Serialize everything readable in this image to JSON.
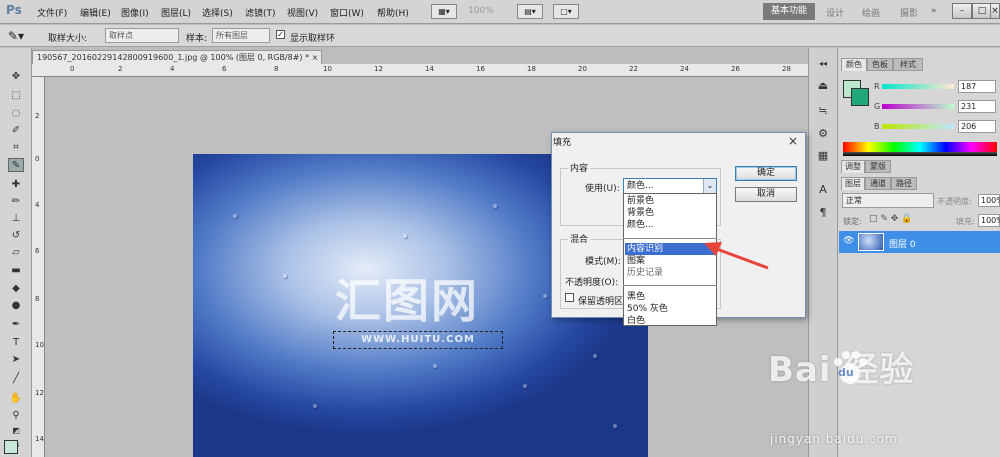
{
  "app": {
    "logo": "Ps"
  },
  "menubar": {
    "items": [
      "文件(F)",
      "编辑(E)",
      "图像(I)",
      "图层(L)",
      "选择(S)",
      "滤镜(T)",
      "视图(V)",
      "窗口(W)",
      "帮助(H)"
    ],
    "zoom": "100%",
    "workspaces": {
      "active": "基本功能",
      "design": "设计",
      "painting": "绘画",
      "photo": "摄影"
    },
    "window_buttons": [
      "–",
      "□",
      "×"
    ]
  },
  "options_bar": {
    "sample_size_label": "取样大小:",
    "sample_size_value": "取样点",
    "sample_label": "样本:",
    "sample_value": "所有图层",
    "show_ring_label": "显示取样环",
    "show_ring_checked": true
  },
  "document": {
    "tab_title": "190567_20160229142800919600_1.jpg @ 100% (图层 0, RGB/8#) * ×",
    "ruler_top": [
      "0",
      "2",
      "4",
      "6",
      "8",
      "10",
      "12",
      "14",
      "16",
      "18",
      "20",
      "22",
      "24",
      "26",
      "28"
    ],
    "ruler_left": [
      "0",
      "2",
      "4",
      "6",
      "8",
      "10",
      "12",
      "14"
    ],
    "watermark_logo": "汇图网",
    "watermark_url": "WWW.HUITU.COM"
  },
  "panels": {
    "color_tabs": [
      "颜色",
      "色板",
      "样式"
    ],
    "rgb": {
      "r_label": "R",
      "r_value": "187",
      "g_label": "G",
      "g_value": "231",
      "b_label": "B",
      "b_value": "206"
    },
    "adjust_tabs": [
      "调整",
      "蒙版"
    ],
    "layer_tabs": [
      "图层",
      "通道",
      "路径"
    ],
    "blend_mode": "正常",
    "opacity_label": "不透明度:",
    "opacity_value": "100%",
    "lock_label": "锁定:",
    "fill_label": "填充:",
    "fill_value": "100%",
    "layer_name": "图层 0"
  },
  "fill_dialog": {
    "title": "填充",
    "close": "×",
    "content_group": "内容",
    "use_label": "使用(U):",
    "use_value": "颜色...",
    "ok": "确定",
    "cancel": "取消",
    "blend_group": "混合",
    "mode_label": "模式(M):",
    "opacity_label": "不透明度(O):",
    "preserve_label": "保留透明区",
    "dropdown_options": [
      "前景色",
      "背景色",
      "颜色...",
      "内容识别",
      "图案",
      "历史记录",
      "黑色",
      "50% 灰色",
      "白色"
    ],
    "selected_option": "内容识别"
  },
  "watermark": {
    "brand": "Bai  经验",
    "paw": "du",
    "url": "jingyan.baidu.com"
  },
  "colors": {
    "accent_selection": "#3b6ecf",
    "layer_highlight": "#3f8ee8",
    "foreground_swatch": "#bbe7ce",
    "arrow": "#e8463c"
  }
}
